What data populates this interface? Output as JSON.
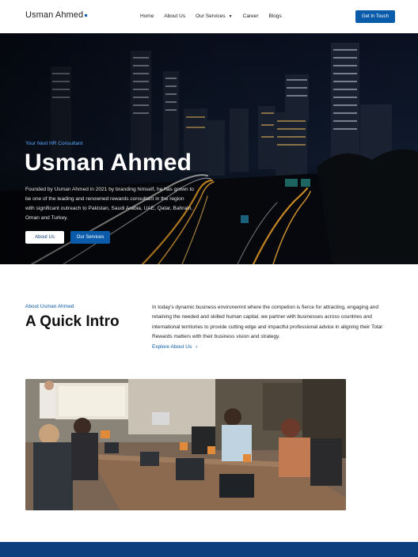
{
  "header": {
    "logo_text": "Usman Ahmed",
    "nav": [
      {
        "label": "Home"
      },
      {
        "label": "About Us"
      },
      {
        "label": "Our Services",
        "has_dropdown": true
      },
      {
        "label": "Career"
      },
      {
        "label": "Blogs"
      }
    ],
    "cta_label": "Get In Touch"
  },
  "hero": {
    "tagline": "Your Next HR Consultant",
    "title": "Usman Ahmed",
    "description": "Founded by Usman Ahmed in 2021 by branding himself, he has grown to be one of the leading and renowned rewards consultant in the region with significant outreach to Pakistan, Saudi Arabia, UAE, Qatar, Bahrain, Oman and Turkey.",
    "about_button": "About Us",
    "services_button": "Our Services"
  },
  "intro": {
    "tagline": "About Usman Ahmed",
    "title": "A Quick Intro",
    "text": "In  today's dynamic business environemnt where the competion is fierce for attracting, engaging and retaining the needed and skilled human capital, we partner with businesses across countries and international territories to provide cutting edge and impactful professional advice in aligning their Total Rewards matters with their business vision and strategy.",
    "link": "Explore About Us",
    "link_arrow": "›"
  },
  "colors": {
    "brand_blue": "#0a5cab",
    "footer_blue": "#0c3f7e",
    "accent_light_blue": "#58a6ff"
  }
}
